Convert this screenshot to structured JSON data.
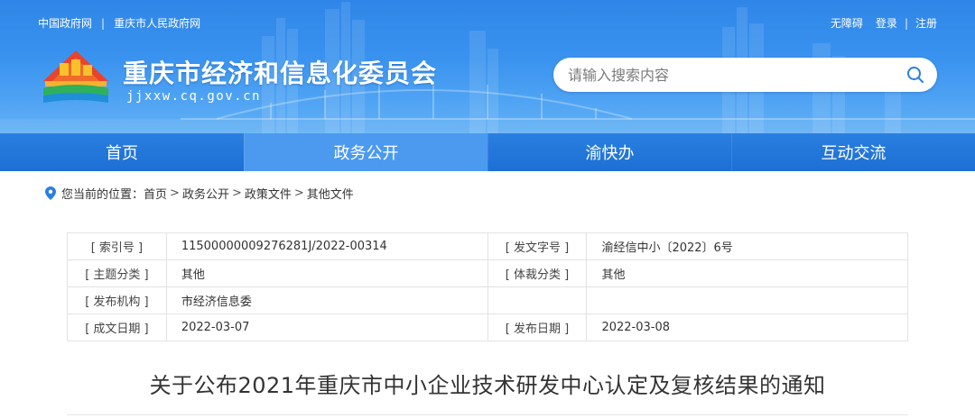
{
  "topbar": {
    "left_links": [
      "中国政府网",
      "重庆市人民政府网"
    ],
    "separator": "|",
    "right_links": [
      "无障碍",
      "登录",
      "注册"
    ]
  },
  "site": {
    "title": "重庆市经济和信息化委员会",
    "domain": "jjxxw.cq.gov.cn"
  },
  "search": {
    "placeholder": "请输入搜索内容"
  },
  "nav": {
    "items": [
      {
        "label": "首页",
        "active": false
      },
      {
        "label": "政务公开",
        "active": true
      },
      {
        "label": "渝快办",
        "active": false
      },
      {
        "label": "互动交流",
        "active": false
      }
    ]
  },
  "breadcrumb": {
    "prefix": "您当前的位置：",
    "items": [
      "首页",
      "政务公开",
      "政策文件",
      "其他文件"
    ],
    "arrow": ">"
  },
  "info": {
    "rows": [
      {
        "l1": "[ 索引号 ]",
        "v1": "11500000009276281J/2022-00314",
        "l2": "[ 发文字号 ]",
        "v2": "渝经信中小〔2022〕6号"
      },
      {
        "l1": "[ 主题分类 ]",
        "v1": "其他",
        "l2": "[ 体裁分类 ]",
        "v2": "其他"
      },
      {
        "l1": "[ 发布机构 ]",
        "v1": "市经济信息委",
        "l2": "",
        "v2": ""
      },
      {
        "l1": "[ 成文日期 ]",
        "v1": "2022-03-07",
        "l2": "[ 发布日期 ]",
        "v2": "2022-03-08"
      }
    ]
  },
  "article": {
    "title": "关于公布2021年重庆市中小企业技术研发中心认定及复核结果的通知"
  },
  "colors": {
    "banner_top": "#2f86e8",
    "nav_bg": "#1d6fd4",
    "nav_active": "#4b9af0",
    "search_icon": "#2a7fe0"
  },
  "icons": {
    "search": "search-icon",
    "location": "location-pin-icon",
    "logo": "site-logo-emblem"
  }
}
